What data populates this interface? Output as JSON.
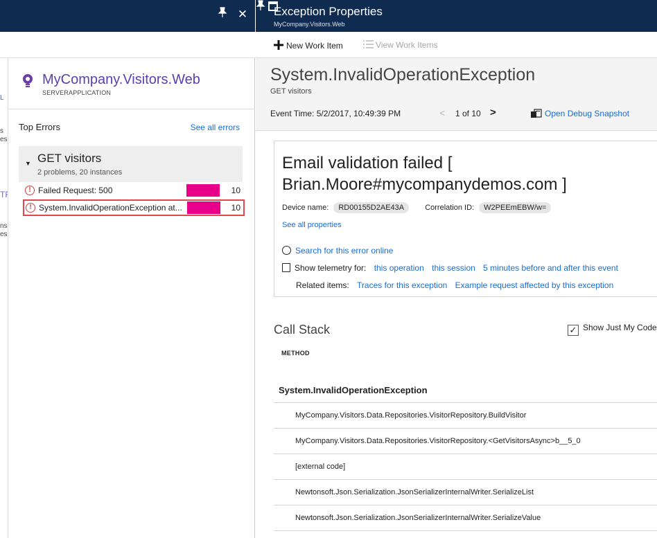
{
  "left_blade": {
    "pin_glyph": "📌",
    "close_glyph": "✕",
    "partial_fragments": [
      "s",
      "es",
      "L",
      "TF",
      "ns",
      "es"
    ],
    "app_title": "MyCompany.Visitors.Web",
    "app_subtitle": "SERVERAPPLICATION",
    "top_errors": {
      "title": "Top Errors",
      "see_all": "See all errors",
      "group_title": "GET visitors",
      "group_subtitle": "2 problems, 20 instances",
      "rows": [
        {
          "label": "Failed Request: 500",
          "count": "10",
          "bar_fraction": 1.0
        },
        {
          "label": "System.InvalidOperationException at...",
          "count": "10",
          "bar_fraction": 1.0
        }
      ]
    }
  },
  "right_blade": {
    "title": "Exception Properties",
    "subtitle": "MyCompany.Visitors.Web",
    "commands": {
      "new_work_item": "New Work Item",
      "view_work_items": "View Work Items"
    },
    "exception": {
      "type": "System.InvalidOperationException",
      "operation": "GET visitors",
      "event_time": "Event Time: 5/2/2017, 10:49:39 PM",
      "page_count": "1 of 10",
      "open_snapshot": "Open Debug Snapshot"
    },
    "message": {
      "text": "Email validation failed [ Brian.Moore#mycompanydemos.com ]",
      "device_label": "Device name:",
      "device_value": "RD00155D2AE43A",
      "correlation_label": "Correlation ID:",
      "correlation_value": "W2PEEmEBW/w=",
      "see_all_properties": "See all properties",
      "search_online": "Search for this error online",
      "show_telemetry_label": "Show telemetry for:",
      "telemetry_links": [
        "this operation",
        "this session",
        "5 minutes before and after this event"
      ],
      "related_label": "Related items:",
      "related_links": [
        "Traces for this exception",
        "Example request affected by this exception"
      ]
    },
    "call_stack": {
      "title": "Call Stack",
      "show_just_my_code": "Show Just My Code",
      "column_header": "METHOD",
      "rows": [
        "System.InvalidOperationException",
        "MyCompany.Visitors.Data.Repositories.VisitorRepository.BuildVisitor",
        "MyCompany.Visitors.Data.Repositories.VisitorRepository.<GetVisitorsAsync>b__5_0",
        "[external code]",
        "Newtonsoft.Json.Serialization.JsonSerializerInternalWriter.SerializeList",
        "Newtonsoft.Json.Serialization.JsonSerializerInternalWriter.SerializeValue"
      ]
    }
  },
  "colors": {
    "header_bg": "#0f2b4f",
    "accent_link": "#1a6dd4",
    "app_purple": "#5b3fae",
    "bar_magenta": "#e8008b",
    "error_red": "#d83b3b"
  },
  "icons": [
    "pin-icon",
    "close-icon",
    "maximize-icon",
    "lightbulb-icon",
    "plus-icon",
    "list-icon",
    "globe-icon",
    "telemetry-icon",
    "snapshot-icon",
    "error-icon",
    "checkbox-icon"
  ]
}
